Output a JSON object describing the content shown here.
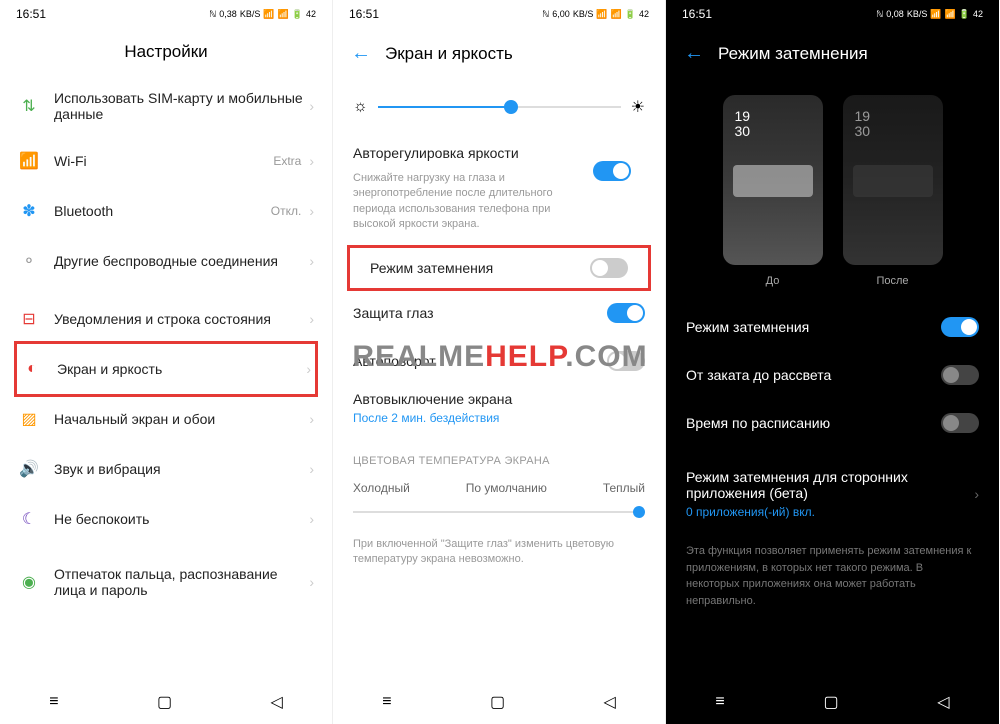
{
  "status": {
    "time": "16:51",
    "net1": "0,38",
    "net2": "6,00",
    "net3": "0,08",
    "unit": "KB/S",
    "bat": "42"
  },
  "s1": {
    "title": "Настройки",
    "sim": "Использовать SIM-карту и мобильные данные",
    "wifi": "Wi-Fi",
    "wifi_extra": "Extra",
    "bt": "Bluetooth",
    "bt_extra": "Откл.",
    "other": "Другие беспроводные соединения",
    "notif": "Уведомления и строка состояния",
    "screen": "Экран и яркость",
    "home": "Начальный экран и обои",
    "sound": "Звук и вибрация",
    "dnd": "Не беспокоить",
    "finger": "Отпечаток пальца, распознавание лица и пароль"
  },
  "s2": {
    "title": "Экран и яркость",
    "auto_bright": "Авторегулировка яркости",
    "auto_bright_desc": "Снижайте нагрузку на глаза и энергопотребление после длительного периода использования телефона при высокой яркости экрана.",
    "dark_mode": "Режим затемнения",
    "eye": "Защита глаз",
    "rotate": "Автоповорот",
    "auto_off": "Автовыключение экрана",
    "auto_off_val": "После 2 мин. бездействия",
    "color_temp": "ЦВЕТОВАЯ ТЕМПЕРАТУРА ЭКРАНА",
    "cold": "Холодный",
    "default": "По умолчанию",
    "warm": "Теплый",
    "foot": "При включенной \"Защите глаз\" изменить цветовую температуру экрана невозможно."
  },
  "s3": {
    "title": "Режим затемнения",
    "before": "До",
    "after": "После",
    "time1": "19",
    "time2": "30",
    "dark_mode": "Режим затемнения",
    "sunset": "От заката до рассвета",
    "schedule": "Время по расписанию",
    "thirdparty": "Режим затемнения для сторонних приложения (бета)",
    "thirdparty_sub": "0 приложения(-ий) вкл.",
    "note": "Эта функция позволяет применять режим затемнения к приложениям, в которых нет такого режима. В некоторых приложениях она может работать неправильно."
  },
  "watermark": {
    "a": "REALME",
    "b": "HELP",
    "c": ".COM"
  }
}
